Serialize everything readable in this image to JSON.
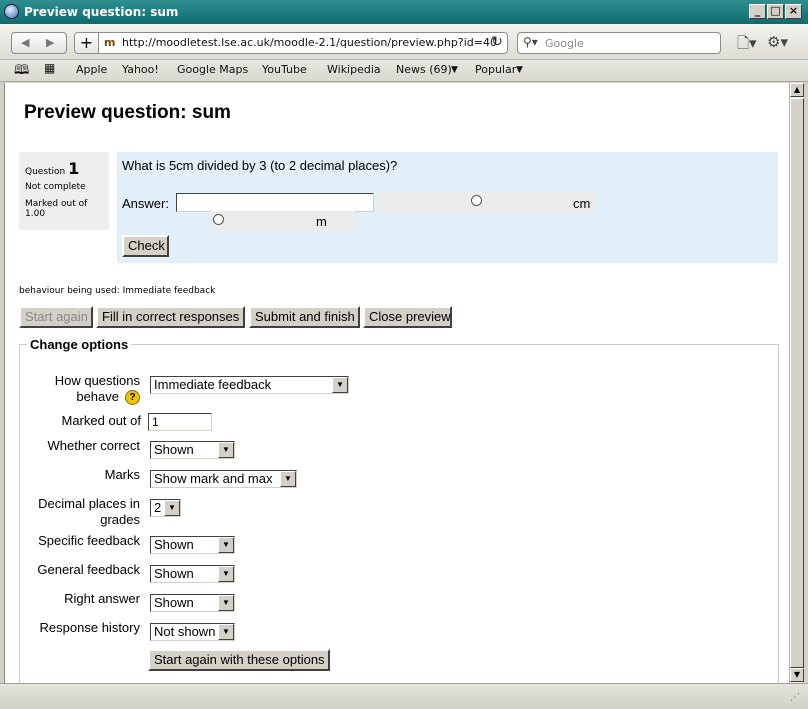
{
  "window": {
    "title": "Preview question: sum"
  },
  "browser": {
    "url": "http://moodletest.lse.ac.uk/moodle-2.1/question/preview.php?id=40",
    "search_placeholder": "Google",
    "bookmarks": [
      "Apple",
      "Yahoo!",
      "Google Maps",
      "YouTube",
      "Wikipedia",
      "News (69)",
      "Popular"
    ]
  },
  "page": {
    "heading": "Preview question: sum",
    "question_info": {
      "question_label": "Question",
      "question_number": "1",
      "state": "Not complete",
      "marked_out_of": "Marked out of",
      "mark_value": "1.00"
    },
    "question_text": "What is 5cm divided by 3 (to 2 decimal places)?",
    "answer_label": "Answer:",
    "answer_value": "",
    "unit_options": [
      "cm",
      "m"
    ],
    "check_button": "Check",
    "behaviour_note": "behaviour being used: Immediate feedback",
    "actions": {
      "start_again": "Start again",
      "fill_correct": "Fill in correct responses",
      "submit_finish": "Submit and finish",
      "close_preview": "Close preview"
    },
    "change_options": {
      "legend": "Change options",
      "how_behave_label_1": "How questions",
      "how_behave_label_2": "behave",
      "how_behave_value": "Immediate feedback",
      "marked_out_of_label": "Marked out of",
      "marked_out_of_value": "1",
      "whether_correct_label": "Whether correct",
      "whether_correct_value": "Shown",
      "marks_label": "Marks",
      "marks_value": "Show mark and max",
      "decimal_label_1": "Decimal places in",
      "decimal_label_2": "grades",
      "decimal_value": "2",
      "specific_feedback_label": "Specific feedback",
      "specific_feedback_value": "Shown",
      "general_feedback_label": "General feedback",
      "general_feedback_value": "Shown",
      "right_answer_label": "Right answer",
      "right_answer_value": "Shown",
      "response_history_label": "Response history",
      "response_history_value": "Not shown",
      "submit_button": "Start again with these options"
    }
  }
}
